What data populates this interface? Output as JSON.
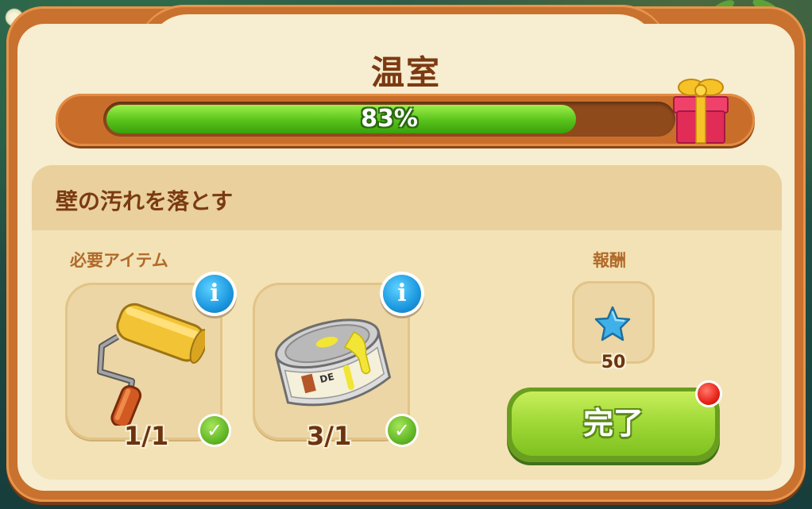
{
  "dialog": {
    "title": "温室",
    "progress": {
      "label": "83%",
      "value_percent": 83
    },
    "reward_chest_icon": "gift-box-icon"
  },
  "task": {
    "title": "壁の汚れを落とす",
    "required_items_label": "必要アイテム",
    "reward_label": "報酬",
    "items": [
      {
        "name": "paint-roller",
        "icon": "paint-roller-icon",
        "count": "1/1",
        "info_label": "i",
        "complete": true
      },
      {
        "name": "paint-can",
        "icon": "paint-can-icon",
        "count": "3/1",
        "info_label": "i",
        "complete": true
      }
    ],
    "reward": {
      "icon": "blue-star-icon",
      "amount": "50"
    },
    "complete_button_label": "完了"
  },
  "colors": {
    "frame_orange": "#c9712e",
    "panel_cream": "#f7edd0",
    "title_brown": "#7b3a12",
    "progress_green": "#58c21a",
    "button_green": "#9ed836",
    "info_blue": "#1c98e0",
    "notify_red": "#e8231a"
  }
}
